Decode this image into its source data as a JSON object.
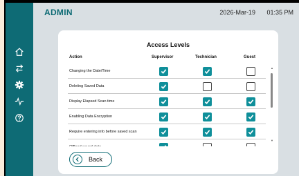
{
  "header": {
    "app_title": "ADMIN",
    "date": "2026-Mar-19",
    "time": "01:35 PM"
  },
  "sidebar": {
    "items": [
      {
        "name": "home-icon"
      },
      {
        "name": "transfer-icon"
      },
      {
        "name": "gear-icon",
        "active": true
      },
      {
        "name": "waveform-icon"
      },
      {
        "name": "help-icon"
      }
    ]
  },
  "access_levels": {
    "title": "Access Levels",
    "columns": [
      "Action",
      "Supervisor",
      "Technician",
      "Guest"
    ],
    "rows": [
      {
        "action": "Changing the Date/Time",
        "supervisor": true,
        "technician": true,
        "guest": false
      },
      {
        "action": "Deleting Saved Data",
        "supervisor": true,
        "technician": false,
        "guest": false
      },
      {
        "action": "Display Elapsed Scan time",
        "supervisor": true,
        "technician": true,
        "guest": true
      },
      {
        "action": "Enabling Data Encryption",
        "supervisor": true,
        "technician": true,
        "guest": true
      },
      {
        "action": "Require entering info before saved scan",
        "supervisor": true,
        "technician": true,
        "guest": true
      },
      {
        "action": "Offload saved data",
        "supervisor": true,
        "technician": false,
        "guest": false
      }
    ]
  },
  "footer": {
    "back_label": "Back"
  },
  "colors": {
    "accent": "#0e6b75",
    "checkbox_on": "#0f8f9a",
    "background": "#d9dfe3"
  }
}
